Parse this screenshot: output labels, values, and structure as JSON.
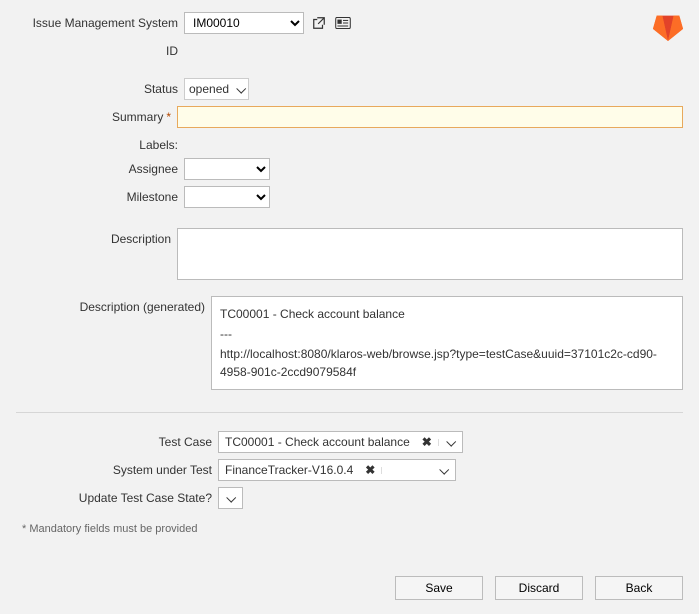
{
  "logo": {
    "name": "gitlab-logo"
  },
  "fields": {
    "ims": {
      "label": "Issue Management System",
      "value": "IM00010"
    },
    "id": {
      "label": "ID",
      "value": ""
    },
    "status": {
      "label": "Status",
      "value": "opened"
    },
    "summary": {
      "label": "Summary",
      "mandatory": "*",
      "value": ""
    },
    "labels": {
      "label": "Labels:"
    },
    "assignee": {
      "label": "Assignee",
      "value": ""
    },
    "milestone": {
      "label": "Milestone",
      "value": ""
    },
    "description": {
      "label": "Description",
      "value": ""
    },
    "description_generated": {
      "label": "Description (generated)",
      "line1": "TC00001 - Check account balance",
      "sep": "---",
      "line2": "http://localhost:8080/klaros-web/browse.jsp?type=testCase&uuid=37101c2c-cd90-4958-901c-2ccd9079584f"
    },
    "test_case": {
      "label": "Test Case",
      "value": "TC00001 - Check account balance"
    },
    "sut": {
      "label": "System under Test",
      "value": "FinanceTracker-V16.0.4"
    },
    "update_state": {
      "label": "Update Test Case State?"
    }
  },
  "note": "* Mandatory fields must be provided",
  "buttons": {
    "save": "Save",
    "discard": "Discard",
    "back": "Back"
  },
  "icons": {
    "clear": "✖"
  }
}
